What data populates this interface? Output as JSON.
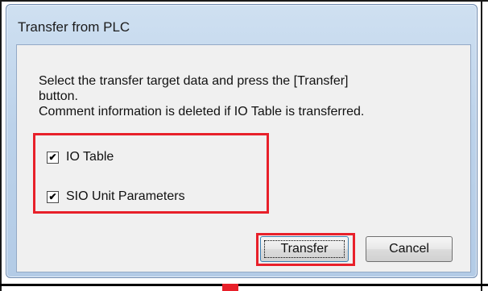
{
  "window": {
    "title": "Transfer from PLC"
  },
  "instructions": {
    "line1": "Select the transfer target data and press the [Transfer]",
    "line2": "button.",
    "line3": "Comment information is deleted if IO Table is transferred."
  },
  "options": [
    {
      "label": "IO Table",
      "checked": true
    },
    {
      "label": "SIO Unit Parameters",
      "checked": true
    }
  ],
  "buttons": {
    "transfer_label": "Transfer",
    "cancel_label": "Cancel"
  },
  "checkmark_glyph": "✔",
  "colors": {
    "highlight": "#e8202a",
    "title_bar": "#bcd2ea",
    "client_bg": "#f0f0f0"
  }
}
